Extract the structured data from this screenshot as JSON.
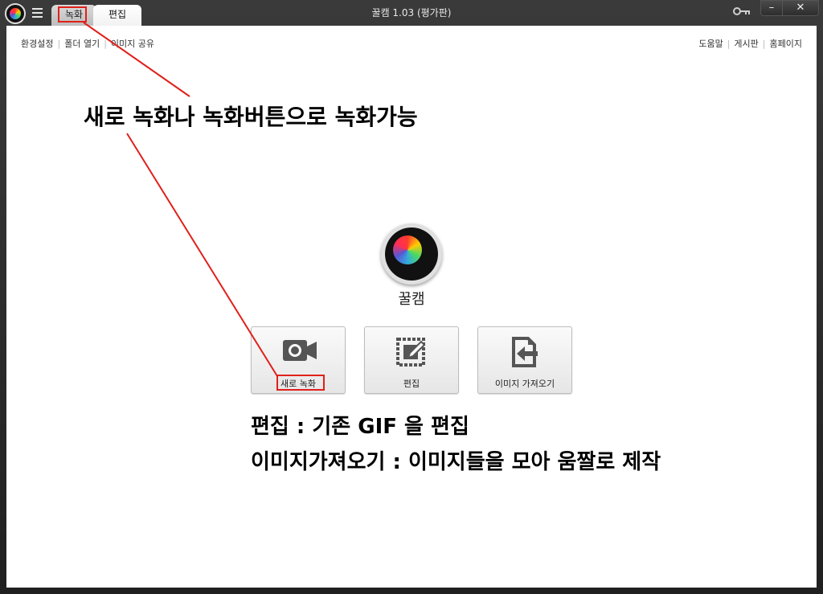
{
  "window": {
    "title": "꿀캠 1.03 (평가판)",
    "tabs": [
      {
        "label": "녹화"
      },
      {
        "label": "편집"
      }
    ],
    "controls": {
      "minimize": "–",
      "close": "✕"
    }
  },
  "toolbar": {
    "left_links": [
      "환경설정",
      "폴더 열기",
      "이미지 공유"
    ],
    "right_links": [
      "도움말",
      "게시판",
      "홈페이지"
    ]
  },
  "main": {
    "app_name": "꿀캠",
    "buttons": [
      {
        "label": "새로 녹화",
        "icon": "video-camera-icon"
      },
      {
        "label": "편집",
        "icon": "edit-image-icon"
      },
      {
        "label": "이미지 가져오기",
        "icon": "import-image-icon"
      }
    ]
  },
  "annotations": {
    "line1": "새로 녹화나 녹화버튼으로 녹화가능",
    "line2": "편집 : 기존 GIF 을 편집",
    "line3": "이미지가져오기 : 이미지들을 모아 움짤로 제작",
    "highlight_color": "#e0201a"
  },
  "colors": {
    "titlebar": "#2b2b2b",
    "content_bg": "#ffffff"
  }
}
